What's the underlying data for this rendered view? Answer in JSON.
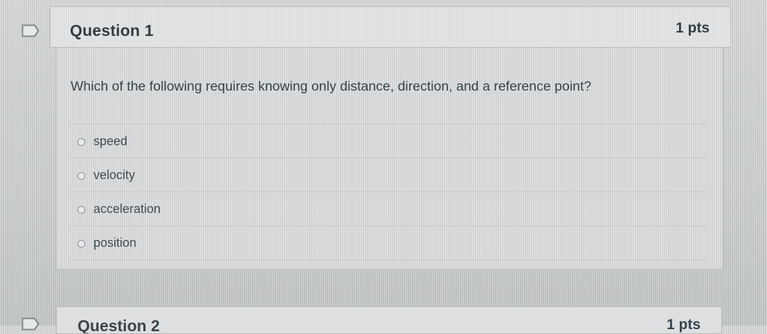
{
  "question": {
    "title": "Question 1",
    "points": "1 pts",
    "text": "Which of the following requires knowing only distance, direction, and a reference point?",
    "answers": [
      {
        "label": "speed"
      },
      {
        "label": "velocity"
      },
      {
        "label": "acceleration"
      },
      {
        "label": "position"
      }
    ]
  },
  "next_question": {
    "title": "Question 2",
    "points": "1 pts"
  },
  "icons": {
    "flag": "bookmark-flag-icon",
    "radio": "radio-unselected-icon"
  }
}
